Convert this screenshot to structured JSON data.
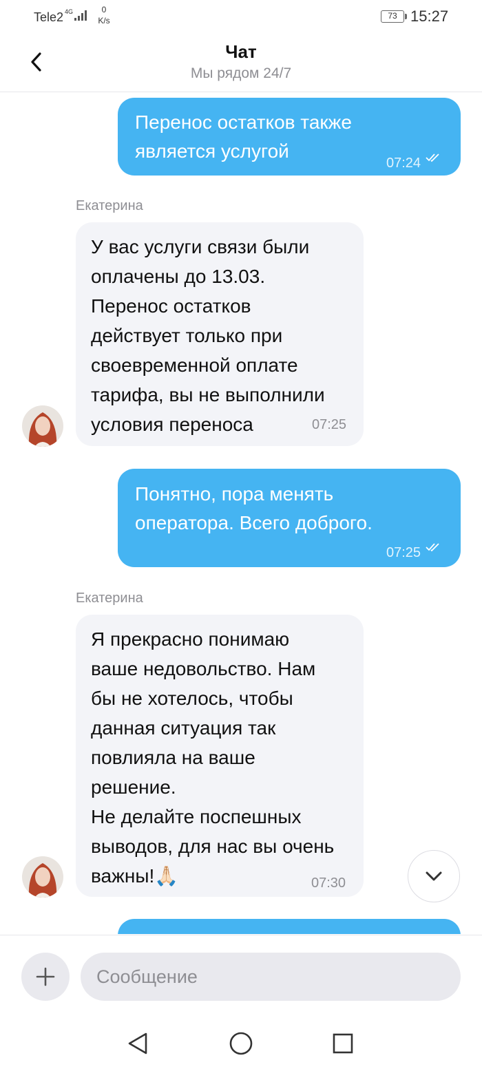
{
  "status_bar": {
    "carrier": "Tele2",
    "network": "4G",
    "speed_value": "0",
    "speed_unit": "K/s",
    "battery": "73",
    "time": "15:27"
  },
  "header": {
    "back_icon": "chevron-left-icon",
    "title": "Чат",
    "subtitle": "Мы рядом 24/7"
  },
  "messages": [
    {
      "direction": "outgoing",
      "text": "Перенос остатков также\nявляется услугой",
      "time": "07:24",
      "status_icon": "double-check-icon"
    },
    {
      "direction": "incoming",
      "sender": "Екатерина",
      "text": "У вас услуги связи были\nоплачены до 13.03.\nПеренос остатков\nдействует только при\nсвоевременной оплате\nтарифа, вы не выполнили\nусловия переноса",
      "time": "07:25"
    },
    {
      "direction": "outgoing",
      "text": "Понятно, пора менять\nоператора. Всего доброго.",
      "time": "07:25",
      "status_icon": "double-check-icon"
    },
    {
      "direction": "incoming",
      "sender": "Екатерина",
      "text": "Я прекрасно понимаю\nваше недовольство. Нам\nбы не хотелось, чтобы\nданная ситуация так\nповлияла на ваше\nрешение.\nНе делайте поспешных\nвыводов, для нас вы очень\nважны!🙏🏻",
      "time": "07:30"
    }
  ],
  "scroll_down_icon": "chevron-down-icon",
  "composer": {
    "attach_icon": "plus-icon",
    "placeholder": "Сообщение"
  },
  "navbar": {
    "back_icon": "triangle-back-icon",
    "home_icon": "circle-home-icon",
    "recents_icon": "square-recents-icon"
  },
  "colors": {
    "outgoing_bubble": "#45b4f2",
    "incoming_bubble": "#f3f4f8",
    "input_bg": "#e9e9ee",
    "muted_text": "#8e8e93"
  }
}
